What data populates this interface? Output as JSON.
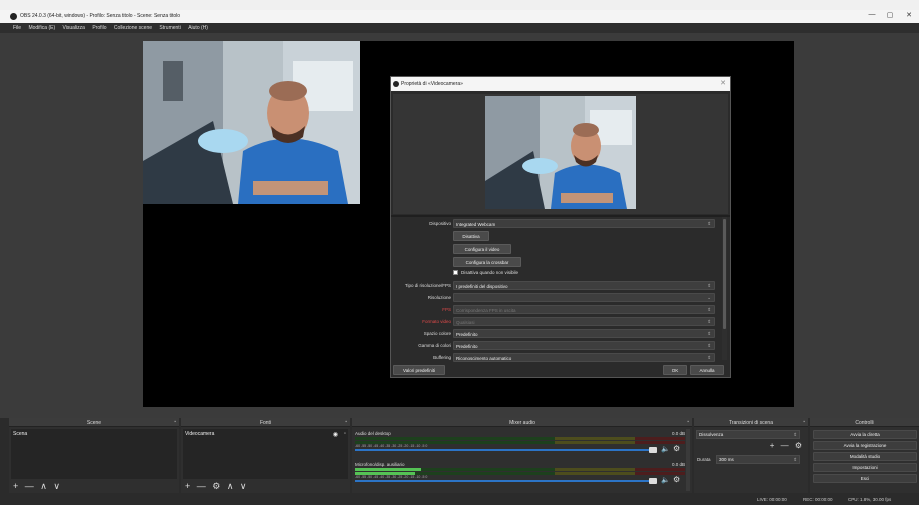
{
  "window": {
    "title": "OBS 24.0.3 (64-bit, windows) - Profilo: Senza titolo - Scene: Senza titolo",
    "minimize": "—",
    "maximize": "▢",
    "close": "✕"
  },
  "menu": [
    "File",
    "Modifica (E)",
    "Visualizza",
    "Profilo",
    "Collezione scene",
    "Strumenti",
    "Aiuto (H)"
  ],
  "dialog": {
    "title": "Proprietà di «Videocamera»",
    "close": "✕",
    "rows": {
      "device_label": "Dispositivo",
      "device_value": "Integrated Webcam",
      "deactivate_btn": "Disattiva",
      "configure_video_btn": "Configura il video",
      "configure_crossbar_btn": "Configura la crossbar",
      "disable_not_visible": "Disattiva quando non visibile",
      "res_type_label": "Tipo di risoluzione/FPS",
      "res_type_value": "I predefiniti del dispositivo",
      "resolution_label": "Risoluzione",
      "resolution_value": "",
      "fps_label": "FPS",
      "fps_value": "Corrispondenza FPS in uscita",
      "video_format_label": "Formato video",
      "video_format_value": "Qualsiasi",
      "color_space_label": "Spazio colore",
      "color_space_value": "Predefinito",
      "color_range_label": "Gamma di colori",
      "color_range_value": "Predefinito",
      "buffering_label": "Buffering",
      "buffering_value": "Riconoscimento automatico"
    },
    "defaults_btn": "Valori predefiniti",
    "ok_btn": "OK",
    "cancel_btn": "Annulla"
  },
  "docks": {
    "scenes": {
      "title": "Scene",
      "items": [
        "Scena"
      ],
      "tools": "+ — ∧ ∨"
    },
    "sources": {
      "title": "Fonti",
      "items": [
        "Videocamera"
      ],
      "tools": "+ — ⚙ ∧ ∨"
    },
    "mixer": {
      "title": "Mixer audio",
      "channels": [
        {
          "name": "Audio del desktop",
          "db": "0.0 dB",
          "level": 0.0
        },
        {
          "name": "Microfono/disp. ausiliario",
          "db": "0.0 dB",
          "level": 0.2
        }
      ],
      "ticks": "-60 -55 -50 -45 -40 -35 -30 -25 -20 -15 -10 -5 0"
    },
    "transitions": {
      "title": "Transizioni di scena",
      "selected": "Dissolvenza",
      "tools": "+ — ⚙",
      "duration_label": "Durata",
      "duration_value": "300 ms"
    },
    "controls": {
      "title": "Controlli",
      "buttons": [
        "Avvia la diretta",
        "Avvia la registrazione",
        "Modalità studio",
        "Impostazioni",
        "Esci"
      ]
    }
  },
  "status": {
    "live": "LIVE: 00:00:00",
    "rec": "REC: 00:00:00",
    "cpu": "CPU: 1.8%, 30.00 fps"
  },
  "icons": {
    "eye": "eye-icon",
    "lock": "lock-icon",
    "speaker": "speaker-icon",
    "gear": "gear-icon"
  }
}
